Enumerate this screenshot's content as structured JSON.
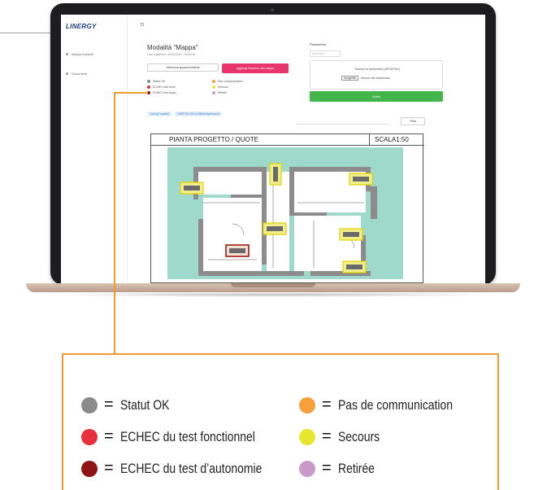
{
  "colors": {
    "accent_orange": "#f29a2e",
    "ok_grey": "#8a8a8a",
    "fail_red": "#e8303a",
    "autonomy_darkred": "#8f1414",
    "no_comm_orange": "#f5a03a",
    "emergency_yellow": "#e7e62e",
    "removed_lilac": "#c89ac9",
    "brand_pink": "#e8356e",
    "brand_green": "#44b54a"
  },
  "app": {
    "logo": "LINERGY",
    "sidebar": [
      {
        "label": "Mappa impianti",
        "icon": "map-icon"
      },
      {
        "label": "Documenti",
        "icon": "document-icon"
      }
    ],
    "title": "Modalità \"Mappa\"",
    "subtitle": "Last registered: 00/00/0000 - 00:00:00",
    "select_button": "Seleziona apparecchiature",
    "add_button": "Aggiungi Schermo alla mappa",
    "chips": [
      "Tutti gli impianti",
      "CAPPELLINI & Affiliati/dipendenti"
    ],
    "panel": {
      "title": "Planimetria",
      "input_placeholder": "Planimetria",
      "drop_text": "Trascina la planimetria (JPEG/PNG)",
      "choose_button": "Scegli file",
      "choose_note": "Nessun file selezionato",
      "submit_button": "Salva",
      "filter_button": "Filtra"
    },
    "mini_legend": [
      {
        "label": "Statut OK",
        "color": "#8a8a8a"
      },
      {
        "label": "ECHEC test fonct.",
        "color": "#e8303a"
      },
      {
        "label": "ECHEC test auton.",
        "color": "#8f1414"
      },
      {
        "label": "Pas communication",
        "color": "#f5a03a"
      },
      {
        "label": "Secours",
        "color": "#e7e62e"
      },
      {
        "label": "Retirée",
        "color": "#c89ac9"
      }
    ]
  },
  "plan": {
    "title": "PIANTA PROGETTO / QUOTE",
    "scale": "SCALA1:50"
  },
  "legend": [
    {
      "label": "Statut OK",
      "color": "#8a8a8a"
    },
    {
      "label": "ECHEC du test fonctionnel",
      "color": "#e8303a"
    },
    {
      "label": "ECHEC du test d’autonomie",
      "color": "#8f1414"
    },
    {
      "label": "Pas de communication",
      "color": "#f5a03a"
    },
    {
      "label": "Secours",
      "color": "#e7e62e"
    },
    {
      "label": "Retirée",
      "color": "#c89ac9"
    }
  ],
  "legend_eq": "="
}
